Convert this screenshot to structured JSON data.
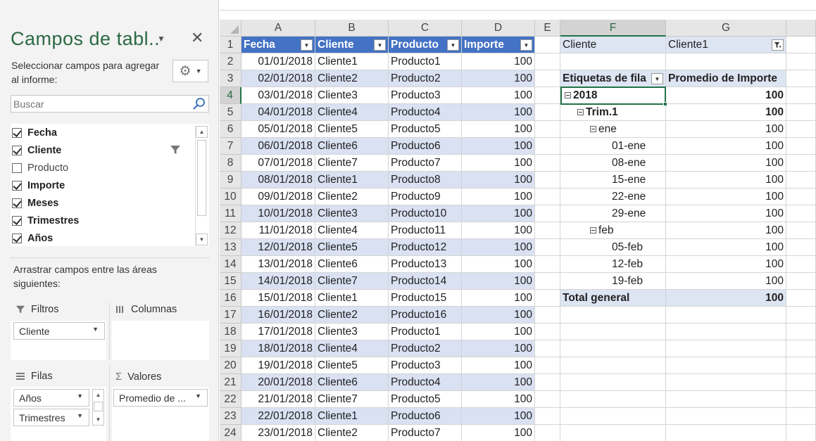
{
  "pane": {
    "title": "Campos de tabl..",
    "description": "Seleccionar campos para agregar al informe:",
    "search_placeholder": "Buscar",
    "fields": [
      {
        "label": "Fecha",
        "checked": true
      },
      {
        "label": "Cliente",
        "checked": true
      },
      {
        "label": "Producto",
        "checked": false
      },
      {
        "label": "Importe",
        "checked": true
      },
      {
        "label": "Meses",
        "checked": true
      },
      {
        "label": "Trimestres",
        "checked": true
      },
      {
        "label": "Años",
        "checked": true
      }
    ],
    "drag_hint": "Arrastrar campos entre las áreas siguientes:",
    "areas": {
      "filters": {
        "title": "Filtros",
        "items": [
          "Cliente"
        ]
      },
      "columns": {
        "title": "Columnas",
        "items": []
      },
      "rows": {
        "title": "Filas",
        "items": [
          "Años",
          "Trimestres"
        ]
      },
      "values": {
        "title": "Valores",
        "items": [
          "Promedio de ..."
        ]
      }
    }
  },
  "sheet": {
    "columns": [
      "A",
      "B",
      "C",
      "D",
      "E",
      "F",
      "G"
    ],
    "selected_column": "F",
    "selected_row": 4,
    "table_headers": [
      "Fecha",
      "Cliente",
      "Producto",
      "Importe"
    ],
    "table_rows": [
      [
        "01/01/2018",
        "Cliente1",
        "Producto1",
        "100"
      ],
      [
        "02/01/2018",
        "Cliente2",
        "Producto2",
        "100"
      ],
      [
        "03/01/2018",
        "Cliente3",
        "Producto3",
        "100"
      ],
      [
        "04/01/2018",
        "Cliente4",
        "Producto4",
        "100"
      ],
      [
        "05/01/2018",
        "Cliente5",
        "Producto5",
        "100"
      ],
      [
        "06/01/2018",
        "Cliente6",
        "Producto6",
        "100"
      ],
      [
        "07/01/2018",
        "Cliente7",
        "Producto7",
        "100"
      ],
      [
        "08/01/2018",
        "Cliente1",
        "Producto8",
        "100"
      ],
      [
        "09/01/2018",
        "Cliente2",
        "Producto9",
        "100"
      ],
      [
        "10/01/2018",
        "Cliente3",
        "Producto10",
        "100"
      ],
      [
        "11/01/2018",
        "Cliente4",
        "Producto11",
        "100"
      ],
      [
        "12/01/2018",
        "Cliente5",
        "Producto12",
        "100"
      ],
      [
        "13/01/2018",
        "Cliente6",
        "Producto13",
        "100"
      ],
      [
        "14/01/2018",
        "Cliente7",
        "Producto14",
        "100"
      ],
      [
        "15/01/2018",
        "Cliente1",
        "Producto15",
        "100"
      ],
      [
        "16/01/2018",
        "Cliente2",
        "Producto16",
        "100"
      ],
      [
        "17/01/2018",
        "Cliente3",
        "Producto1",
        "100"
      ],
      [
        "18/01/2018",
        "Cliente4",
        "Producto2",
        "100"
      ],
      [
        "19/01/2018",
        "Cliente5",
        "Producto3",
        "100"
      ],
      [
        "20/01/2018",
        "Cliente6",
        "Producto4",
        "100"
      ],
      [
        "21/01/2018",
        "Cliente7",
        "Producto5",
        "100"
      ],
      [
        "22/01/2018",
        "Cliente1",
        "Producto6",
        "100"
      ],
      [
        "23/01/2018",
        "Cliente2",
        "Producto7",
        "100"
      ]
    ],
    "pivot": {
      "filter_label": "Cliente",
      "filter_value": "Cliente1",
      "row_labels_header": "Etiquetas de fila",
      "value_header": "Promedio de Importe",
      "rows": [
        {
          "label": "2018",
          "value": "100",
          "level": 0,
          "bold": true,
          "collapsible": true
        },
        {
          "label": "Trim.1",
          "value": "100",
          "level": 1,
          "bold": true,
          "collapsible": true
        },
        {
          "label": "ene",
          "value": "100",
          "level": 2,
          "bold": false,
          "collapsible": true
        },
        {
          "label": "01-ene",
          "value": "100",
          "level": 3,
          "bold": false,
          "collapsible": false
        },
        {
          "label": "08-ene",
          "value": "100",
          "level": 3,
          "bold": false,
          "collapsible": false
        },
        {
          "label": "15-ene",
          "value": "100",
          "level": 3,
          "bold": false,
          "collapsible": false
        },
        {
          "label": "22-ene",
          "value": "100",
          "level": 3,
          "bold": false,
          "collapsible": false
        },
        {
          "label": "29-ene",
          "value": "100",
          "level": 3,
          "bold": false,
          "collapsible": false
        },
        {
          "label": "feb",
          "value": "100",
          "level": 2,
          "bold": false,
          "collapsible": true
        },
        {
          "label": "05-feb",
          "value": "100",
          "level": 3,
          "bold": false,
          "collapsible": false
        },
        {
          "label": "12-feb",
          "value": "100",
          "level": 3,
          "bold": false,
          "collapsible": false
        },
        {
          "label": "19-feb",
          "value": "100",
          "level": 3,
          "bold": false,
          "collapsible": false
        }
      ],
      "grand_total_label": "Total general",
      "grand_total_value": "100"
    }
  },
  "colors": {
    "table_header": "#4472c4",
    "table_band": "#d9e1f2",
    "pivot_header": "#dde5f3",
    "accent": "#217346",
    "pane_title": "#2b6a44"
  },
  "icons": [
    "settings-gear-icon",
    "search-icon",
    "filter-funnel-icon",
    "close-icon",
    "columns-icon",
    "rows-icon",
    "sigma-icon",
    "expand-collapse-minus-icon"
  ]
}
